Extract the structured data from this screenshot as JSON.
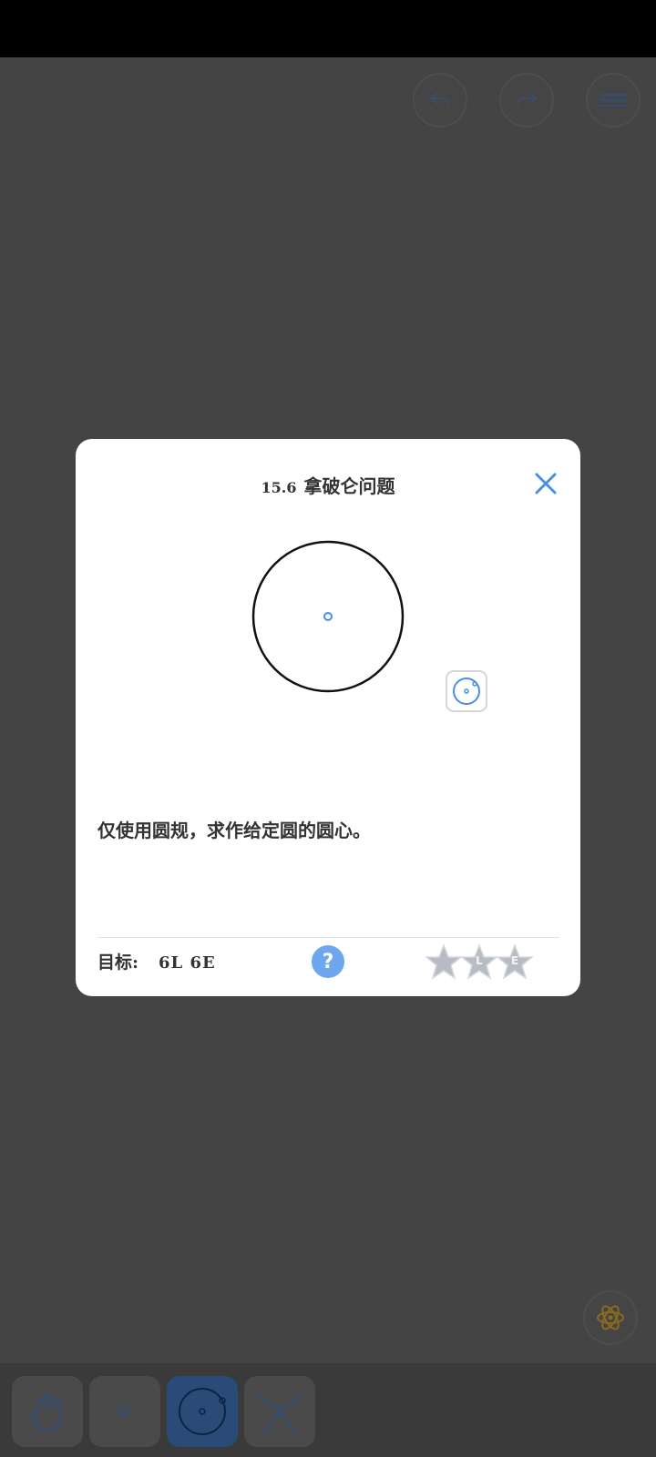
{
  "dialog": {
    "level_number": "15.6",
    "level_title": "拿破仑问题",
    "description": "仅使用圆规，求作给定圆的圆心。",
    "goal_label": "目标:",
    "goal_value": "6L 6E",
    "help_label": "?",
    "stars": [
      "",
      "L",
      "E"
    ]
  },
  "colors": {
    "accent": "#4a90e2",
    "star_gray": "#b7bcc4"
  },
  "icons": {
    "undo": "undo-arrow-icon",
    "redo": "redo-arrow-icon",
    "menu": "hamburger-menu-icon",
    "settings": "atom-settings-icon",
    "close": "close-x-icon"
  }
}
